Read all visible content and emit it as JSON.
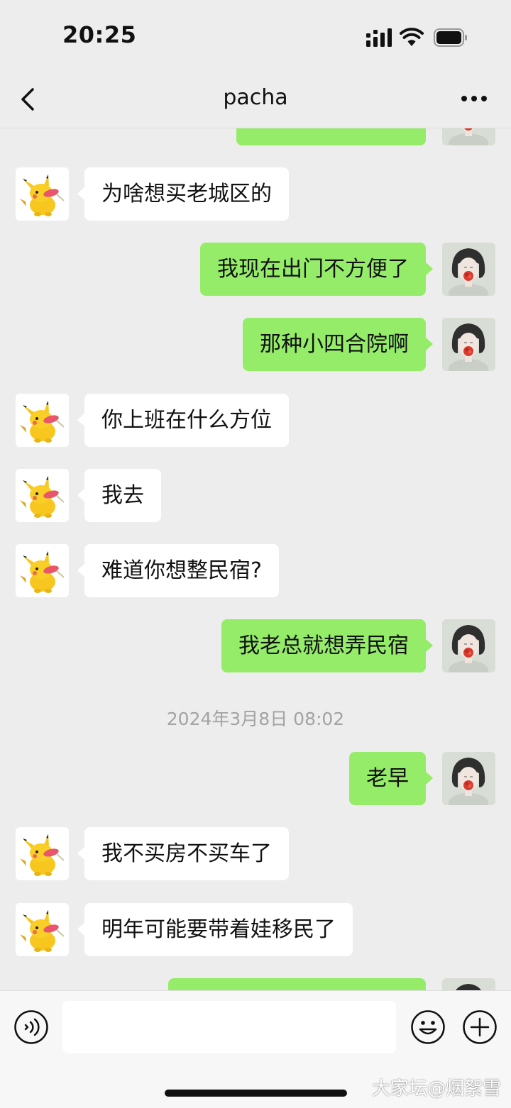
{
  "status_bar": {
    "time": "20:25"
  },
  "header": {
    "title": "pacha"
  },
  "messages": [
    {
      "side": "right",
      "text": ""
    },
    {
      "side": "left",
      "text": "为啥想买老城区的"
    },
    {
      "side": "right",
      "text": "我现在出门不方便了"
    },
    {
      "side": "right",
      "text": "那种小四合院啊"
    },
    {
      "side": "left",
      "text": "你上班在什么方位"
    },
    {
      "side": "left",
      "text": "我去"
    },
    {
      "side": "left",
      "text": "难道你想整民宿?"
    },
    {
      "side": "right",
      "text": "我老总就想弄民宿"
    },
    {
      "side": "right",
      "text": "老早"
    },
    {
      "side": "left",
      "text": "我不买房不买车了"
    },
    {
      "side": "left",
      "text": "明年可能要带着娃移民了"
    },
    {
      "side": "right",
      "text": ""
    }
  ],
  "timestamp": "2024年3月8日 08:02",
  "input": {
    "value": "",
    "placeholder": ""
  },
  "watermark": "大家坛@烟絮雪",
  "colors": {
    "background": "#ededed",
    "self_bubble": "#95ec69",
    "other_bubble": "#ffffff"
  },
  "icons": {
    "back": "chevron-left-icon",
    "more": "more-dots-icon",
    "voice": "voice-icon",
    "emoji": "emoji-icon",
    "plus": "plus-circle-icon"
  }
}
